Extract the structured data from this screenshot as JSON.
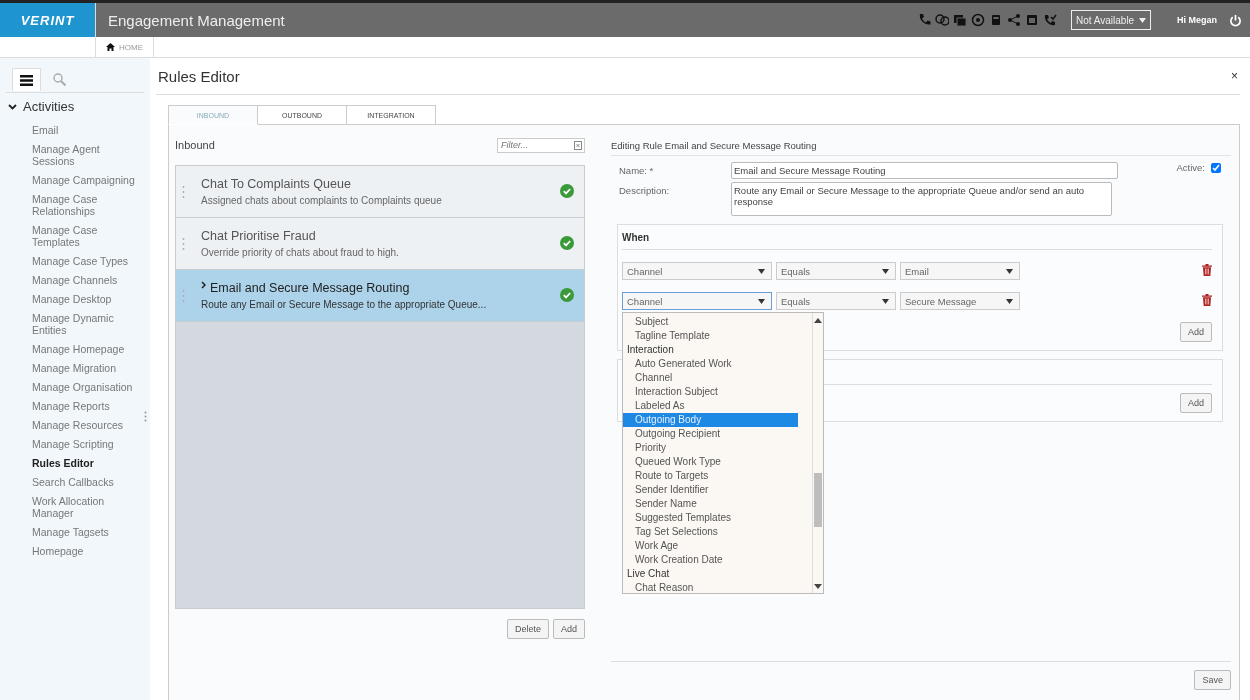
{
  "header": {
    "logo": "VERINT",
    "app_title": "Engagement Management",
    "status": "Not Available",
    "greeting": "Hi Megan"
  },
  "breadcrumb": {
    "home": "HOME"
  },
  "sidebar": {
    "section": "Activities",
    "expanded": true,
    "items": [
      {
        "label": "Email",
        "selected": false
      },
      {
        "label": "Manage Agent Sessions",
        "selected": false
      },
      {
        "label": "Manage Campaigning",
        "selected": false
      },
      {
        "label": "Manage Case Relationships",
        "selected": false
      },
      {
        "label": "Manage Case Templates",
        "selected": false
      },
      {
        "label": "Manage Case Types",
        "selected": false
      },
      {
        "label": "Manage Channels",
        "selected": false
      },
      {
        "label": "Manage Desktop",
        "selected": false
      },
      {
        "label": "Manage Dynamic Entities",
        "selected": false
      },
      {
        "label": "Manage Homepage",
        "selected": false
      },
      {
        "label": "Manage Migration",
        "selected": false
      },
      {
        "label": "Manage Organisation",
        "selected": false
      },
      {
        "label": "Manage Reports",
        "selected": false
      },
      {
        "label": "Manage Resources",
        "selected": false
      },
      {
        "label": "Manage Scripting",
        "selected": false
      },
      {
        "label": "Rules Editor",
        "selected": true
      },
      {
        "label": "Search Callbacks",
        "selected": false
      },
      {
        "label": "Work Allocation Manager",
        "selected": false
      },
      {
        "label": "Manage Tagsets",
        "selected": false
      },
      {
        "label": "Homepage",
        "selected": false
      }
    ]
  },
  "page": {
    "title": "Rules Editor",
    "close": "×"
  },
  "tabs": [
    {
      "label": "INBOUND",
      "selected": true
    },
    {
      "label": "OUTBOUND",
      "selected": false
    },
    {
      "label": "INTEGRATION",
      "selected": false
    }
  ],
  "rules_list": {
    "title": "Inbound",
    "filter_placeholder": "Filter...",
    "rules": [
      {
        "title": "Chat To Complaints Queue",
        "description": "Assigned chats about complaints to Complaints queue",
        "active": true,
        "selected": false
      },
      {
        "title": "Chat Prioritise Fraud",
        "description": "Override priority of chats about fraud to high.",
        "active": true,
        "selected": false
      },
      {
        "title": "Email and Secure Message Routing",
        "description": "Route any Email or Secure Message to the appropriate Queue...",
        "active": true,
        "selected": true
      }
    ],
    "buttons": [
      "Delete",
      "Add"
    ]
  },
  "editor": {
    "heading": "Editing Rule Email and Secure Message Routing",
    "name_label": "Name: *",
    "name_value": "Email and Secure Message Routing",
    "description_label": "Description:",
    "description_value": "Route any Email or Secure Message to the appropriate Queue and/or send an auto response",
    "active_label": "Active:",
    "active": true,
    "when": {
      "title": "When",
      "add_button": "Add",
      "conditions": [
        {
          "field": "Channel",
          "operator": "Equals",
          "value": "Email",
          "open": false
        },
        {
          "field": "Channel",
          "operator": "Equals",
          "value": "Secure Message",
          "open": true
        }
      ]
    },
    "then": {
      "add_button": "Add"
    },
    "field_options": [
      {
        "label": "Subject",
        "kind": "option",
        "selected": false
      },
      {
        "label": "Tagline Template",
        "kind": "option",
        "selected": false
      },
      {
        "label": "Interaction",
        "kind": "group",
        "selected": false
      },
      {
        "label": "Auto Generated Work",
        "kind": "option",
        "selected": false
      },
      {
        "label": "Channel",
        "kind": "option",
        "selected": false
      },
      {
        "label": "Interaction Subject",
        "kind": "option",
        "selected": false
      },
      {
        "label": "Labeled As",
        "kind": "option",
        "selected": false
      },
      {
        "label": "Outgoing Body",
        "kind": "option",
        "selected": true
      },
      {
        "label": "Outgoing Recipient",
        "kind": "option",
        "selected": false
      },
      {
        "label": "Priority",
        "kind": "option",
        "selected": false
      },
      {
        "label": "Queued Work Type",
        "kind": "option",
        "selected": false
      },
      {
        "label": "Route to Targets",
        "kind": "option",
        "selected": false
      },
      {
        "label": "Sender Identifier",
        "kind": "option",
        "selected": false
      },
      {
        "label": "Sender Name",
        "kind": "option",
        "selected": false
      },
      {
        "label": "Suggested Templates",
        "kind": "option",
        "selected": false
      },
      {
        "label": "Tag Set Selections",
        "kind": "option",
        "selected": false
      },
      {
        "label": "Work Age",
        "kind": "option",
        "selected": false
      },
      {
        "label": "Work Creation Date",
        "kind": "option",
        "selected": false
      },
      {
        "label": "Live Chat",
        "kind": "group",
        "selected": false
      },
      {
        "label": "Chat Reason",
        "kind": "option",
        "selected": false
      }
    ],
    "save_button": "Save"
  }
}
